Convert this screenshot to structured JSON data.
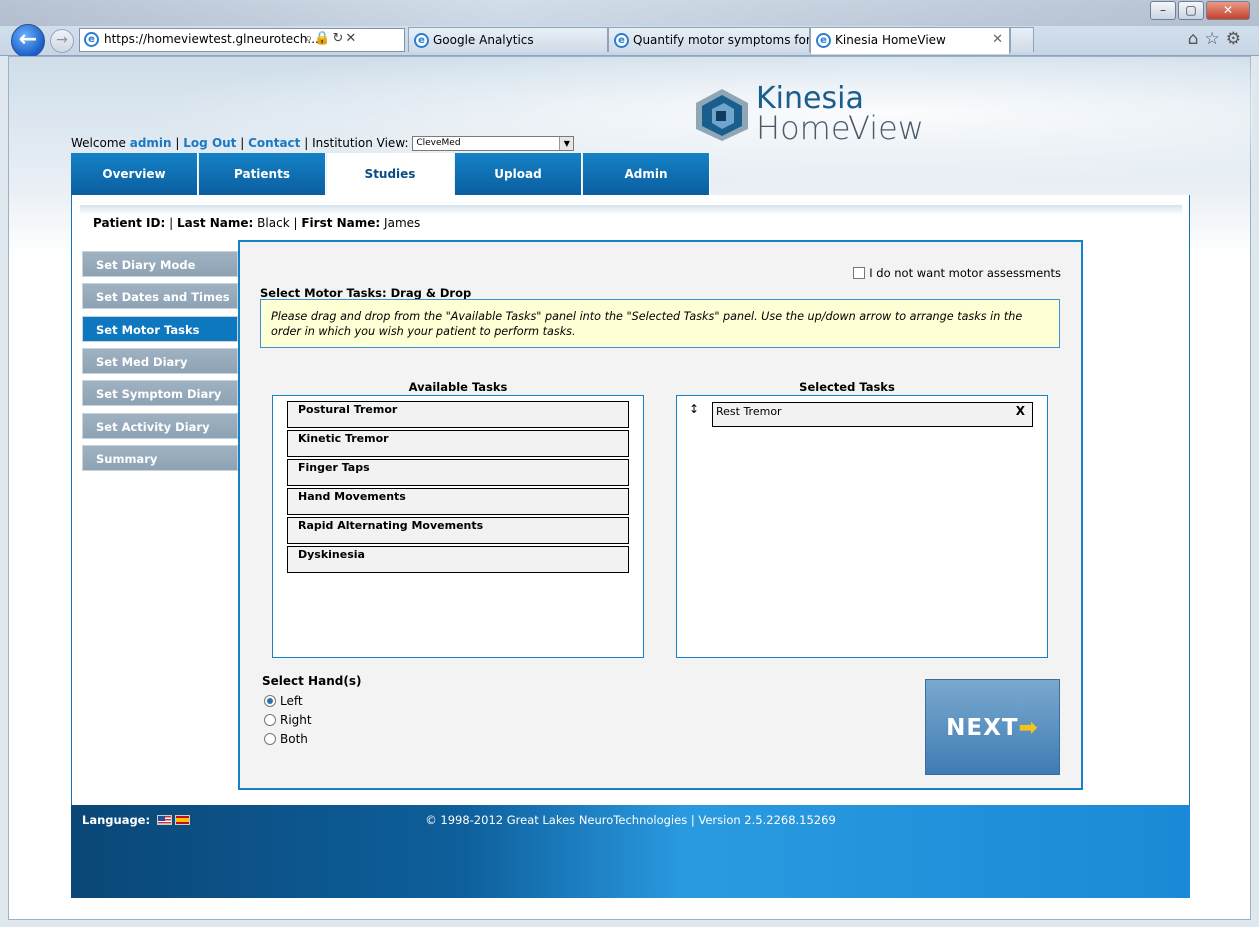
{
  "browser": {
    "url": "https://homeviewtest.glneurotech....",
    "tabs": [
      {
        "label": "Google Analytics"
      },
      {
        "label": "Quantify motor symptoms for ..."
      },
      {
        "label": "Kinesia HomeView"
      }
    ]
  },
  "header": {
    "logo_line1": "Kinesia",
    "logo_line2": "HomeView",
    "welcome_prefix": "Welcome",
    "user": "admin",
    "logout": "Log Out",
    "contact": "Contact",
    "institution_label": "Institution View:",
    "institution_value": "CleveMed",
    "separator": "|"
  },
  "nav": {
    "tabs": [
      {
        "label": "Overview"
      },
      {
        "label": "Patients"
      },
      {
        "label": "Studies"
      },
      {
        "label": "Upload"
      },
      {
        "label": "Admin"
      }
    ]
  },
  "patient": {
    "id_label": "Patient ID:",
    "last_name_label": "Last Name:",
    "last_name": "Black",
    "first_name_label": "First Name:",
    "first_name": "James"
  },
  "sidebar": {
    "items": [
      {
        "label": "Set Diary Mode"
      },
      {
        "label": "Set Dates and Times"
      },
      {
        "label": "Set Motor Tasks"
      },
      {
        "label": "Set Med Diary"
      },
      {
        "label": "Set Symptom Diary"
      },
      {
        "label": "Set Activity Diary"
      },
      {
        "label": "Summary"
      }
    ]
  },
  "motor": {
    "opt_out_label": "I do not want motor assessments",
    "title": "Select Motor Tasks: Drag & Drop",
    "instructions": "Please drag and drop from the \"Available Tasks\" panel into the \"Selected Tasks\" panel. Use the up/down arrow to arrange tasks in the order in which you wish your patient to perform tasks.",
    "available_title": "Available Tasks",
    "selected_title": "Selected Tasks",
    "available": [
      {
        "label": "Postural Tremor"
      },
      {
        "label": "Kinetic Tremor"
      },
      {
        "label": "Finger Taps"
      },
      {
        "label": "Hand Movements"
      },
      {
        "label": "Rapid Alternating Movements"
      },
      {
        "label": "Dyskinesia"
      }
    ],
    "selected": [
      {
        "label": "Rest Tremor",
        "handle": "↕",
        "remove": "X"
      }
    ]
  },
  "hands": {
    "title": "Select Hand(s)",
    "options": [
      {
        "label": "Left",
        "checked": true
      },
      {
        "label": "Right",
        "checked": false
      },
      {
        "label": "Both",
        "checked": false
      }
    ]
  },
  "next_button": {
    "label": "NEXT",
    "arrow": "➡"
  },
  "footer": {
    "language_label": "Language:",
    "copyright": "© 1998-2012 Great Lakes NeuroTechnologies | Version 2.5.2268.15269"
  },
  "colors": {
    "accent": "#1582c7",
    "sidebar_inactive": "#9fb2c2",
    "instructions_bg": "#ffffd6"
  }
}
